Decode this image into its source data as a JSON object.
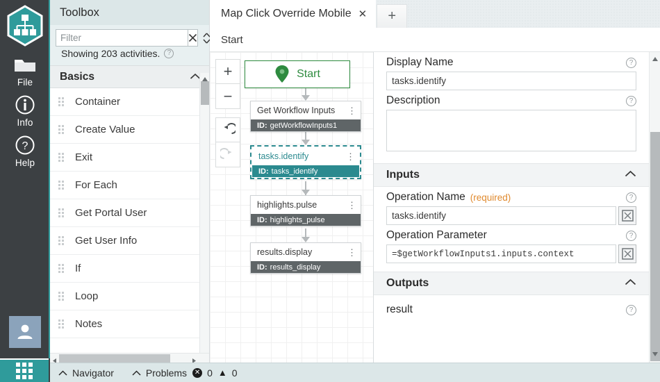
{
  "rail": {
    "logo_icon": "sitemap-hex-logo",
    "items": [
      {
        "icon": "folder-icon",
        "label": "File"
      },
      {
        "icon": "info-circle-icon",
        "label": "Info"
      },
      {
        "icon": "question-circle-icon",
        "label": "Help"
      }
    ],
    "avatar_icon": "user-avatar-icon",
    "apps_icon": "app-grid-icon"
  },
  "toolbox": {
    "title": "Toolbox",
    "filter_placeholder": "Filter",
    "filter_value": "",
    "clear_icon": "close-x-icon",
    "sort_icon": "sort-updown-icon",
    "count_text": "Showing 203 activities.",
    "help_icon": "?",
    "group": {
      "label": "Basics",
      "chevron": "⌃"
    },
    "items": [
      {
        "label": "Container"
      },
      {
        "label": "Create Value"
      },
      {
        "label": "Exit"
      },
      {
        "label": "For Each"
      },
      {
        "label": "Get Portal User"
      },
      {
        "label": "Get User Info"
      },
      {
        "label": "If"
      },
      {
        "label": "Loop"
      },
      {
        "label": "Notes"
      }
    ]
  },
  "tabs": {
    "active": {
      "title": "Map Click Override Mobile",
      "close_icon": "✕"
    },
    "new_tab_icon": "+"
  },
  "breadcrumb": {
    "text": "Start"
  },
  "canvas": {
    "zoom_controls": [
      {
        "name": "zoom-in",
        "glyph": "+",
        "disabled": false
      },
      {
        "name": "zoom-out",
        "glyph": "−",
        "disabled": false
      },
      {
        "name": "undo",
        "glyph": "↺",
        "disabled": false
      },
      {
        "name": "redo",
        "glyph": "↻",
        "disabled": true
      }
    ],
    "start_node": {
      "label": "Start",
      "icon": "map-pin-icon"
    },
    "nodes": [
      {
        "title": "Get Workflow Inputs",
        "id_prefix": "ID:",
        "id": "getWorkflowInputs1",
        "selected": false,
        "kebab": "⋮"
      },
      {
        "title": "tasks.identify",
        "id_prefix": "ID:",
        "id": "tasks_identify",
        "selected": true,
        "kebab": "⋮"
      },
      {
        "title": "highlights.pulse",
        "id_prefix": "ID:",
        "id": "highlights_pulse",
        "selected": false,
        "kebab": "⋮"
      },
      {
        "title": "results.display",
        "id_prefix": "ID:",
        "id": "results_display",
        "selected": false,
        "kebab": "⋮"
      }
    ]
  },
  "properties": {
    "display_name": {
      "label": "Display Name",
      "value": "tasks.identify",
      "help": "?"
    },
    "description": {
      "label": "Description",
      "value": "",
      "help": "?"
    },
    "inputs_section": {
      "label": "Inputs",
      "chevron": "⌃"
    },
    "operation_name": {
      "label": "Operation Name",
      "required_text": "(required)",
      "value": "tasks.identify",
      "help": "?",
      "expand_icon": "expand-editor-icon"
    },
    "operation_parameter": {
      "label": "Operation Parameter",
      "value": "=$getWorkflowInputs1.inputs.context",
      "help": "?",
      "expand_icon": "expand-editor-icon"
    },
    "outputs_section": {
      "label": "Outputs",
      "chevron": "⌃"
    },
    "outputs": [
      {
        "name": "result",
        "help": "?"
      }
    ]
  },
  "statusbar": {
    "navigator": {
      "label": "Navigator",
      "chevron": "⌃"
    },
    "problems": {
      "label": "Problems",
      "chevron": "⌃"
    },
    "errors": {
      "icon": "error-circle-icon",
      "count": "0"
    },
    "warnings": {
      "icon": "warning-triangle-icon",
      "count": "0"
    }
  },
  "colors": {
    "accent_teal": "#2f9b9b",
    "selection_teal": "#2b8a8f",
    "rail_dark": "#3c4043",
    "start_green": "#2e8b3f",
    "required_orange": "#e08a2e",
    "node_id_gray": "#5f6567"
  }
}
